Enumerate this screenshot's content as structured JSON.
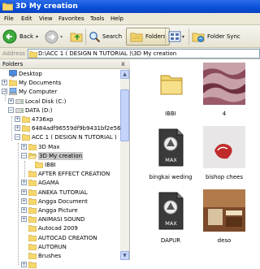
{
  "window": {
    "title": "3D My creation"
  },
  "menu": [
    "File",
    "Edit",
    "View",
    "Favorites",
    "Tools",
    "Help"
  ],
  "toolbar": {
    "back_label": "Back",
    "search_label": "Search",
    "folders_label": "Folders",
    "folder_sync_label": "Folder Sync"
  },
  "address": {
    "label": "Address",
    "value": "D:\\ACC 1 ( DESIGN N TUTORIAL )\\3D My creation"
  },
  "folders_pane": {
    "title": "Folders",
    "close": "x",
    "tree": [
      {
        "label": "Desktop",
        "icon": "desktop-icon",
        "expander": ""
      },
      {
        "label": "My Documents",
        "icon": "folder-icon",
        "expander": "+"
      },
      {
        "label": "My Computer",
        "icon": "computer-icon",
        "expander": "-"
      },
      {
        "label": "Local Disk (C:)",
        "icon": "drive-icon",
        "expander": "+"
      },
      {
        "label": "DATA (D:)",
        "icon": "drive-icon",
        "expander": "-"
      },
      {
        "label": "4736xp",
        "icon": "folder-icon",
        "expander": "+"
      },
      {
        "label": "6484adf96559df9b9431bf2e56",
        "icon": "folder-icon",
        "expander": "+"
      },
      {
        "label": "ACC 1 ( DESIGN N TUTORIAL )",
        "icon": "folder-icon",
        "expander": "-"
      },
      {
        "label": "3D Max",
        "icon": "folder-icon",
        "expander": "+"
      },
      {
        "label": "3D My creation",
        "icon": "folder-open-icon",
        "expander": "-"
      },
      {
        "label": "IBBI",
        "icon": "folder-icon",
        "expander": ""
      },
      {
        "label": "AFTER EFFECT CREATION",
        "icon": "folder-icon",
        "expander": ""
      },
      {
        "label": "AGAMA",
        "icon": "folder-icon",
        "expander": "+"
      },
      {
        "label": "ANEKA TUTORIAL",
        "icon": "folder-icon",
        "expander": "+"
      },
      {
        "label": "Angga Document",
        "icon": "folder-icon",
        "expander": "+"
      },
      {
        "label": "Angga Picture",
        "icon": "folder-icon",
        "expander": "+"
      },
      {
        "label": "ANIMASI SOUND",
        "icon": "folder-icon",
        "expander": "+"
      },
      {
        "label": "Autocad 2009",
        "icon": "folder-icon",
        "expander": ""
      },
      {
        "label": "AUTOCAD CREATION",
        "icon": "folder-icon",
        "expander": ""
      },
      {
        "label": "AUTORUN",
        "icon": "folder-icon",
        "expander": ""
      },
      {
        "label": "Brushes",
        "icon": "folder-icon",
        "expander": ""
      },
      {
        "label": "",
        "icon": "folder-icon",
        "expander": "+"
      }
    ]
  },
  "files": [
    {
      "name": "IBBI",
      "type": "folder-icon"
    },
    {
      "name": "4",
      "type": "image-thumbnail"
    },
    {
      "name": "bingkai weding",
      "type": "max-file-icon"
    },
    {
      "name": "bishop chees",
      "type": "image-thumbnail"
    },
    {
      "name": "DAPUR",
      "type": "max-file-icon"
    },
    {
      "name": "deso",
      "type": "image-thumbnail"
    }
  ],
  "max_badge": "MAX",
  "colors": {
    "titlebar": "#0a4fd8",
    "chrome": "#ece9d8",
    "folder": "#f2d46a",
    "selection": "#c8c8c8"
  }
}
